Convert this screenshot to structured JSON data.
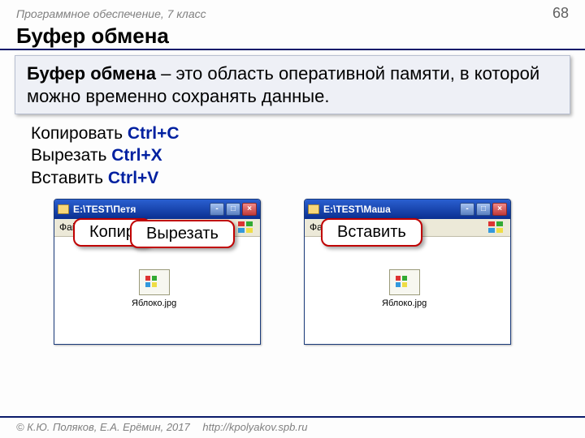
{
  "header": {
    "course": "Программное обеспечение, 7 класс",
    "page": "68"
  },
  "title": "Буфер обмена",
  "definition": {
    "term": "Буфер обмена",
    "dash": " – ",
    "text": "это область оперативной памяти, в которой можно временно сохранять данные."
  },
  "shortcuts": {
    "copy_label": "Копировать ",
    "copy_key": "Ctrl+C",
    "cut_label": "Вырезать ",
    "cut_key": "Ctrl+X",
    "paste_label": "Вставить ",
    "paste_key": "Ctrl+V"
  },
  "windows": {
    "left": {
      "title": "E:\\TEST\\Петя",
      "menu_file": "Файл",
      "file_label": "Яблоко.jpg"
    },
    "right": {
      "title": "E:\\TEST\\Маша",
      "menu_file": "Файл",
      "file_label": "Яблоко.jpg"
    }
  },
  "callouts": {
    "copy": "Копир",
    "cut": "Вырезать",
    "paste": "Вставить"
  },
  "footer": {
    "authors": "© К.Ю. Поляков, Е.А. Ерёмин, 2017",
    "url": "http://kpolyakov.spb.ru"
  }
}
